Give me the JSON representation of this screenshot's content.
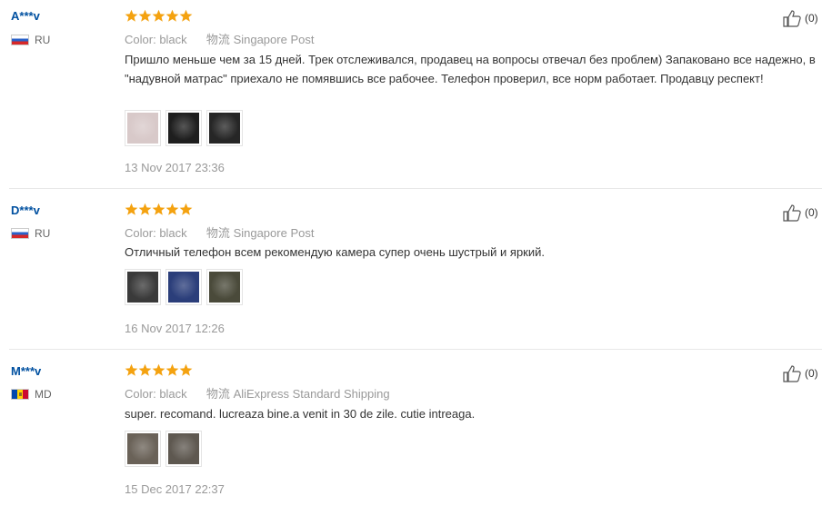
{
  "reviews": [
    {
      "user": "A***v",
      "country": "RU",
      "flag": "ru",
      "rating": 5,
      "color_label": "Color:",
      "color_value": "black",
      "ship_label": "物流",
      "ship_value": "Singapore Post",
      "text": "Пришло меньше чем за 15 дней. Трек отслеживался, продавец на вопросы отвечал без проблем) Запаковано все надежно, в \"надувной матрас\" приехало не помявшись все рабочее. Телефон проверил, все норм работает. Продавцу респект!",
      "date": "13 Nov 2017 23:36",
      "helpful": "(0)",
      "photos": [
        "#d8c9c9",
        "#1e1e1e",
        "#262626"
      ]
    },
    {
      "user": "D***v",
      "country": "RU",
      "flag": "ru",
      "rating": 5,
      "color_label": "Color:",
      "color_value": "black",
      "ship_label": "物流",
      "ship_value": "Singapore Post",
      "text": "Отличный телефон всем рекомендую камера супер очень шустрый и яркий.",
      "date": "16 Nov 2017 12:26",
      "helpful": "(0)",
      "photos": [
        "#3a3a3a",
        "#2b3e7a",
        "#4a4a3a"
      ]
    },
    {
      "user": "M***v",
      "country": "MD",
      "flag": "md",
      "rating": 5,
      "color_label": "Color:",
      "color_value": "black",
      "ship_label": "物流",
      "ship_value": "AliExpress Standard Shipping",
      "text": "super. recomand. lucreaza bine.a venit in 30 de zile. cutie intreaga.",
      "date": "15 Dec 2017 22:37",
      "helpful": "(0)",
      "photos": [
        "#6a6258",
        "#5e5850"
      ]
    }
  ],
  "star_color": "#f4a210",
  "link_color": "#0050a0"
}
